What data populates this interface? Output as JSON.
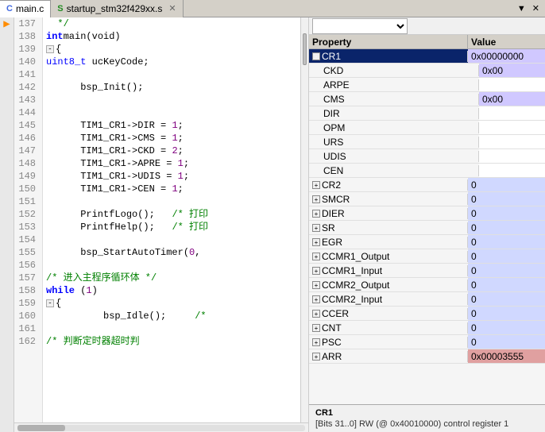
{
  "tabs": [
    {
      "id": "main-c",
      "label": "main.c",
      "icon": "c-icon",
      "active": true,
      "closable": false
    },
    {
      "id": "startup",
      "label": "startup_stm32f429xx.s",
      "icon": "s-icon",
      "active": false,
      "closable": true
    }
  ],
  "tabBarControls": {
    "dropdown": "▼",
    "close": "✕"
  },
  "codeLines": [
    {
      "num": 137,
      "text": "  */",
      "fold": false,
      "highlight": false
    },
    {
      "num": 138,
      "text": "  int main(void)",
      "fold": false,
      "highlight": false,
      "hasKw": true
    },
    {
      "num": 139,
      "text": "  {",
      "fold": true,
      "foldChar": "-",
      "highlight": false
    },
    {
      "num": 140,
      "text": "      uint8_t ucKeyCode;",
      "fold": false,
      "highlight": false
    },
    {
      "num": 141,
      "text": "",
      "fold": false,
      "highlight": false
    },
    {
      "num": 142,
      "text": "      bsp_Init();",
      "fold": false,
      "highlight": false
    },
    {
      "num": 143,
      "text": "",
      "fold": false,
      "highlight": false
    },
    {
      "num": 144,
      "text": "",
      "fold": false,
      "highlight": false
    },
    {
      "num": 145,
      "text": "      TIM1_CR1->DIR = 1;",
      "fold": false,
      "highlight": false
    },
    {
      "num": 146,
      "text": "      TIM1_CR1->CMS = 1;",
      "fold": false,
      "highlight": false
    },
    {
      "num": 147,
      "text": "      TIM1_CR1->CKD = 2;",
      "fold": false,
      "highlight": false
    },
    {
      "num": 148,
      "text": "      TIM1_CR1->APRE = 1;",
      "fold": false,
      "highlight": false
    },
    {
      "num": 149,
      "text": "      TIM1_CR1->UDIS = 1;",
      "fold": false,
      "highlight": false
    },
    {
      "num": 150,
      "text": "      TIM1_CR1->CEN = 1;",
      "fold": false,
      "highlight": false
    },
    {
      "num": 151,
      "text": "",
      "fold": false,
      "highlight": false
    },
    {
      "num": 152,
      "text": "      PrintfLogo();   /* 打印",
      "fold": false,
      "highlight": false
    },
    {
      "num": 153,
      "text": "      PrintfHelp();   /* 打印",
      "fold": false,
      "highlight": false
    },
    {
      "num": 154,
      "text": "",
      "fold": false,
      "highlight": false
    },
    {
      "num": 155,
      "text": "      bsp_StartAutoTimer(0,",
      "fold": false,
      "highlight": false
    },
    {
      "num": 156,
      "text": "",
      "fold": false,
      "highlight": false
    },
    {
      "num": 157,
      "text": "      /* 进入主程序循环体 */",
      "fold": false,
      "highlight": false
    },
    {
      "num": 158,
      "text": "      while (1)",
      "fold": false,
      "highlight": false
    },
    {
      "num": 159,
      "text": "      {",
      "fold": true,
      "foldChar": "-",
      "highlight": false
    },
    {
      "num": 160,
      "text": "          bsp_Idle();     /*",
      "fold": false,
      "highlight": false
    },
    {
      "num": 161,
      "text": "",
      "fold": false,
      "highlight": false
    },
    {
      "num": 162,
      "text": "          /* 判断定时器超时判",
      "fold": false,
      "highlight": false
    }
  ],
  "rightPanel": {
    "dropdown": "",
    "tableHeaders": {
      "property": "Property",
      "value": "Value"
    },
    "registers": [
      {
        "id": "CR1",
        "label": "CR1",
        "expand": true,
        "indent": 0,
        "value": "0x00000000",
        "valueBg": "purple",
        "selected": true
      },
      {
        "id": "CKD",
        "label": "CKD",
        "expand": false,
        "indent": 1,
        "value": "0x00",
        "valueBg": "purple"
      },
      {
        "id": "ARPE",
        "label": "ARPE",
        "expand": false,
        "indent": 1,
        "value": "",
        "valueBg": "white"
      },
      {
        "id": "CMS",
        "label": "CMS",
        "expand": false,
        "indent": 1,
        "value": "0x00",
        "valueBg": "purple"
      },
      {
        "id": "DIR",
        "label": "DIR",
        "expand": false,
        "indent": 1,
        "value": "",
        "valueBg": "white"
      },
      {
        "id": "OPM",
        "label": "OPM",
        "expand": false,
        "indent": 1,
        "value": "",
        "valueBg": "white"
      },
      {
        "id": "URS",
        "label": "URS",
        "expand": false,
        "indent": 1,
        "value": "",
        "valueBg": "white"
      },
      {
        "id": "UDIS",
        "label": "UDIS",
        "expand": false,
        "indent": 1,
        "value": "",
        "valueBg": "white"
      },
      {
        "id": "CEN",
        "label": "CEN",
        "expand": false,
        "indent": 1,
        "value": "",
        "valueBg": "white"
      },
      {
        "id": "CR2",
        "label": "CR2",
        "expand": false,
        "indent": 0,
        "value": "0",
        "valueBg": "blue"
      },
      {
        "id": "SMCR",
        "label": "SMCR",
        "expand": false,
        "indent": 0,
        "value": "0",
        "valueBg": "blue"
      },
      {
        "id": "DIER",
        "label": "DIER",
        "expand": false,
        "indent": 0,
        "value": "0",
        "valueBg": "blue"
      },
      {
        "id": "SR",
        "label": "SR",
        "expand": false,
        "indent": 0,
        "value": "0",
        "valueBg": "blue"
      },
      {
        "id": "EGR",
        "label": "EGR",
        "expand": false,
        "indent": 0,
        "value": "0",
        "valueBg": "blue"
      },
      {
        "id": "CCMR1_Output",
        "label": "CCMR1_Output",
        "expand": false,
        "indent": 0,
        "value": "0",
        "valueBg": "blue"
      },
      {
        "id": "CCMR1_Input",
        "label": "CCMR1_Input",
        "expand": false,
        "indent": 0,
        "value": "0",
        "valueBg": "blue"
      },
      {
        "id": "CCMR2_Output",
        "label": "CCMR2_Output",
        "expand": false,
        "indent": 0,
        "value": "0",
        "valueBg": "blue"
      },
      {
        "id": "CCMR2_Input",
        "label": "CCMR2_Input",
        "expand": false,
        "indent": 0,
        "value": "0",
        "valueBg": "blue"
      },
      {
        "id": "CCER",
        "label": "CCER",
        "expand": false,
        "indent": 0,
        "value": "0",
        "valueBg": "blue"
      },
      {
        "id": "CNT",
        "label": "CNT",
        "expand": false,
        "indent": 0,
        "value": "0",
        "valueBg": "blue"
      },
      {
        "id": "PSC",
        "label": "PSC",
        "expand": false,
        "indent": 0,
        "value": "0",
        "valueBg": "blue"
      },
      {
        "id": "ARR",
        "label": "ARR",
        "expand": false,
        "indent": 0,
        "value": "0x00003555",
        "valueBg": "blue"
      }
    ],
    "statusTitle": "CR1",
    "statusDesc": "[Bits 31..0] RW (@ 0x40010000) control register 1"
  }
}
